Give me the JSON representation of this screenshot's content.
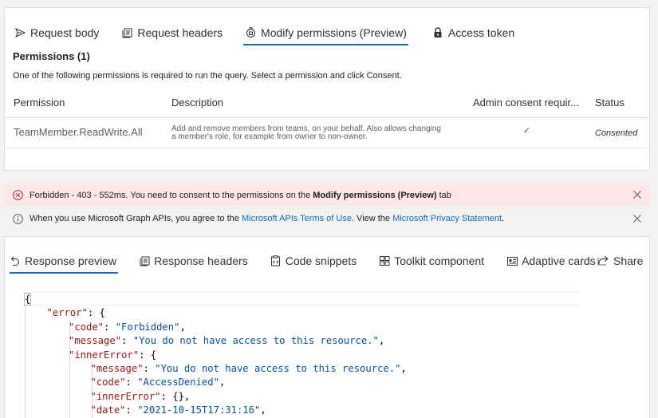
{
  "request_tabs": [
    {
      "label": "Request body",
      "icon": "send-icon",
      "active": false
    },
    {
      "label": "Request headers",
      "icon": "document-icon",
      "active": false
    },
    {
      "label": "Modify permissions (Preview)",
      "icon": "lock-shield-icon",
      "active": true
    },
    {
      "label": "Access token",
      "icon": "lock-icon",
      "active": false
    }
  ],
  "permissions": {
    "title": "Permissions (1)",
    "description": "One of the following permissions is required to run the query. Select a permission and click Consent.",
    "columns": [
      "Permission",
      "Description",
      "Admin consent requir...",
      "Status"
    ],
    "rows": [
      {
        "permission": "TeamMember.ReadWrite.All",
        "description": "Add and remove members from teams, on your behalf. Also allows changing a member's role, for example from owner to non-owner.",
        "admin_consent": "✓",
        "status": "Consented"
      }
    ]
  },
  "error_bar": {
    "text_before": "Forbidden - 403 - 552ms. You need to consent to the permissions on the ",
    "bold": "Modify permissions (Preview)",
    "text_after": " tab"
  },
  "info_bar": {
    "text1": "When you use Microsoft Graph APIs, you agree to the ",
    "link1": "Microsoft APIs Terms of Use",
    "text2": ". View the ",
    "link2": "Microsoft Privacy Statement",
    "text3": "."
  },
  "response_tabs": [
    {
      "label": "Response preview",
      "icon": "undo-arrow-icon",
      "active": true
    },
    {
      "label": "Response headers",
      "icon": "document-icon",
      "active": false
    },
    {
      "label": "Code snippets",
      "icon": "code-clipboard-icon",
      "active": false
    },
    {
      "label": "Toolkit component",
      "icon": "toolkit-icon",
      "active": false
    },
    {
      "label": "Adaptive cards",
      "icon": "card-icon",
      "active": false
    }
  ],
  "share_label": "Share",
  "colors": {
    "accent": "#0f6cbd",
    "error_bg": "#fde7e9",
    "error_icon": "#a4262c",
    "json_key": "#a31515",
    "json_string": "#0451a5"
  },
  "response_json_lines": [
    {
      "indent": 0,
      "parts": [
        [
          "p",
          "{"
        ]
      ]
    },
    {
      "indent": 1,
      "parts": [
        [
          "k",
          "\"error\""
        ],
        [
          "p",
          ": {"
        ]
      ]
    },
    {
      "indent": 2,
      "parts": [
        [
          "k",
          "\"code\""
        ],
        [
          "p",
          ": "
        ],
        [
          "s",
          "\"Forbidden\""
        ],
        [
          "p",
          ","
        ]
      ]
    },
    {
      "indent": 2,
      "parts": [
        [
          "k",
          "\"message\""
        ],
        [
          "p",
          ": "
        ],
        [
          "s",
          "\"You do not have access to this resource.\""
        ],
        [
          "p",
          ","
        ]
      ]
    },
    {
      "indent": 2,
      "parts": [
        [
          "k",
          "\"innerError\""
        ],
        [
          "p",
          ": {"
        ]
      ]
    },
    {
      "indent": 3,
      "parts": [
        [
          "k",
          "\"message\""
        ],
        [
          "p",
          ": "
        ],
        [
          "s",
          "\"You do not have access to this resource.\""
        ],
        [
          "p",
          ","
        ]
      ]
    },
    {
      "indent": 3,
      "parts": [
        [
          "k",
          "\"code\""
        ],
        [
          "p",
          ": "
        ],
        [
          "s",
          "\"AccessDenied\""
        ],
        [
          "p",
          ","
        ]
      ]
    },
    {
      "indent": 3,
      "parts": [
        [
          "k",
          "\"innerError\""
        ],
        [
          "p",
          ": {},"
        ]
      ]
    },
    {
      "indent": 3,
      "parts": [
        [
          "k",
          "\"date\""
        ],
        [
          "p",
          ": "
        ],
        [
          "s",
          "\"2021-10-15T17:31:16\""
        ],
        [
          "p",
          ","
        ]
      ]
    }
  ]
}
